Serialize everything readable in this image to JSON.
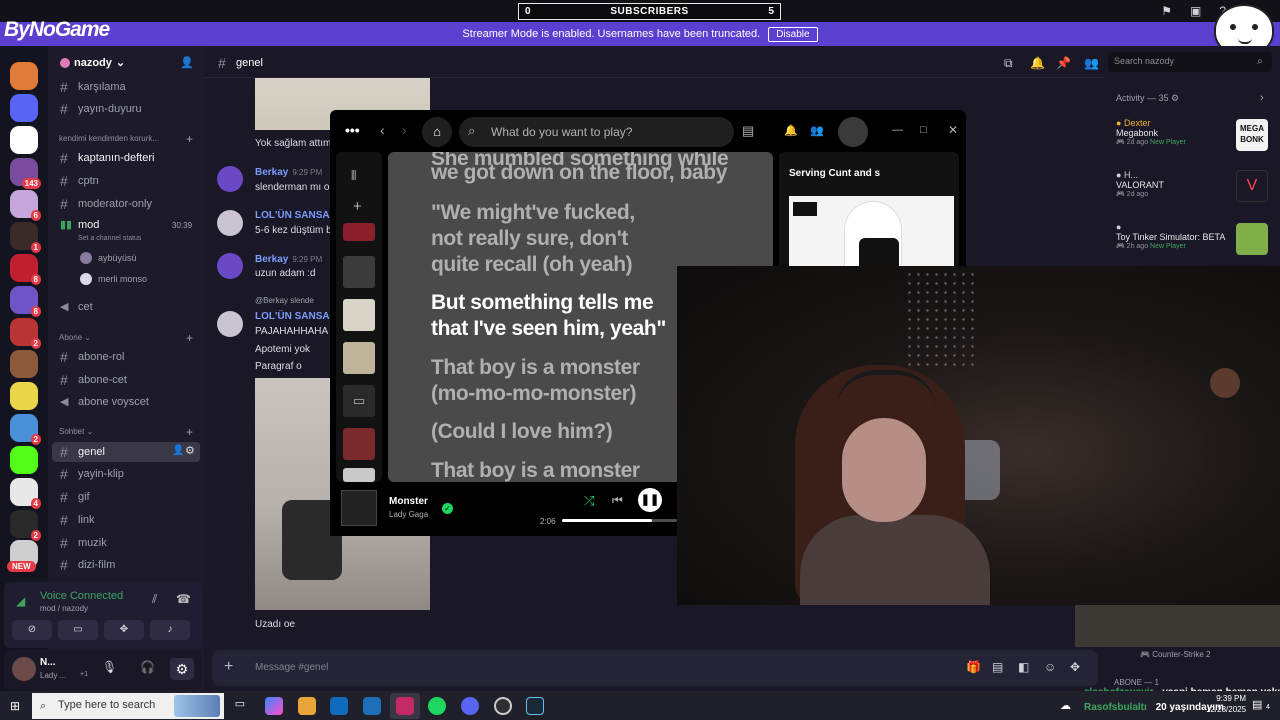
{
  "overlay": {
    "subscribers_label": "SUBSCRIBERS",
    "subscribers_left": "0",
    "subscribers_right": "5",
    "logo_text": "ByNoGame",
    "streamer_mode_text": "Streamer Mode is enabled. Usernames have been truncated.",
    "disable_label": "Disable"
  },
  "server": {
    "name": "nazody",
    "badges": [
      "143",
      "6",
      "1",
      "8",
      "8",
      "2",
      "2",
      "4",
      "2"
    ],
    "new_badge": "NEW"
  },
  "channels": {
    "karsilama": "karşılama",
    "yayin_duyuru": "yayın-duyuru",
    "cat_kendimi": "kendimi kendimden korurk...",
    "kaptan": "kaptanın-defteri",
    "cptn": "cptn",
    "moderator": "moderator-only",
    "mod": "mod",
    "mod_time": "30:39",
    "set_status": "Set a channel status",
    "voice_user1": "aybüyüsü",
    "voice_user2": "merli monso",
    "cet": "cet",
    "cat_abone": "Abone",
    "abone_rol": "abone-rol",
    "abone_cet": "abone-cet",
    "abone_voyscet": "abone voyscet",
    "cat_sohbet": "Sohbet",
    "genel": "genel",
    "yayin_klip": "yayin-klip",
    "gif": "gif",
    "link": "link",
    "muzik": "muzik",
    "dizi_film": "dizi-film"
  },
  "voice_panel": {
    "status": "Voice Connected",
    "location": "mod / nazody"
  },
  "user_panel": {
    "name": "N...",
    "activity": "Lady ...",
    "extra": "+1"
  },
  "chat": {
    "channel": "genel",
    "messages": [
      {
        "text": "Yok sağlam attım"
      },
      {
        "author": "Berkay",
        "time": "9:29 PM",
        "text": "slenderman mı o"
      },
      {
        "author": "LOL'ÜN SANSAR",
        "text": "5-6 kez düştüm b"
      },
      {
        "author": "Berkay",
        "time": "9:29 PM",
        "text": "uzun adam :d"
      },
      {
        "reply": "@Berkay slende",
        "author": "LOL'ÜN SANSAR",
        "lines": [
          "PAJAHAHHAHA",
          "Apotemi yok",
          "Paragraf o"
        ]
      },
      {
        "text": "Uzadı oe"
      }
    ],
    "composer_placeholder": "Message #genel"
  },
  "right_sidebar": {
    "search_placeholder": "Search nazody",
    "activity_header": "Activity — 35",
    "activities": [
      {
        "user": "Dexter",
        "game": "Megabonk",
        "ago": "2d ago",
        "tag": "New Player",
        "thumb_text": "MEGA BONK"
      },
      {
        "user": "H...",
        "game": "VALORANT",
        "ago": "2d ago"
      },
      {
        "game": "Toy Tinker Simulator: BETA",
        "ago": "2h ago",
        "tag": "New Player"
      }
    ],
    "cs_label": "Counter-Strike 2",
    "abone_count": "ABONE — 1"
  },
  "spotify": {
    "search_placeholder": "What do you want to play?",
    "lyrics": [
      {
        "text": "She mumbled something while",
        "active": false
      },
      {
        "text": "we got down on the floor, baby",
        "active": false
      },
      {
        "text": "\"We might've fucked,",
        "active": false
      },
      {
        "text": "not really sure, don't",
        "active": false
      },
      {
        "text": "quite recall (oh yeah)",
        "active": false
      },
      {
        "text": "But something tells me",
        "active": true
      },
      {
        "text": "that I've seen him, yeah\"",
        "active": true
      },
      {
        "text": "That boy is a monster",
        "active": false
      },
      {
        "text": "(mo-mo-mo-monster)",
        "active": false
      },
      {
        "text": "(Could I love him?)",
        "active": false
      },
      {
        "text": "That boy is a monster",
        "active": false
      }
    ],
    "playlist_title": "Serving Cunt and s",
    "now_playing": {
      "title": "Monster",
      "artist": "Lady Gaga",
      "elapsed": "2:06",
      "progress": 0.78
    }
  },
  "stream_chat": [
    {
      "user": "slashofzeusvir",
      "message": "yaani hemen hemen yakın old"
    },
    {
      "user": "Rasofsbulaltı",
      "message": "20 yaşındayım"
    }
  ],
  "taskbar": {
    "search_placeholder": "Type here to search",
    "time": "9:39 PM",
    "date": "12/28/2025",
    "notifications": "4"
  },
  "colors": {
    "accent": "#5b3fd0",
    "spotify_green": "#1ed760",
    "badge_red": "#e63946",
    "mention_blue": "#7b9cff"
  }
}
